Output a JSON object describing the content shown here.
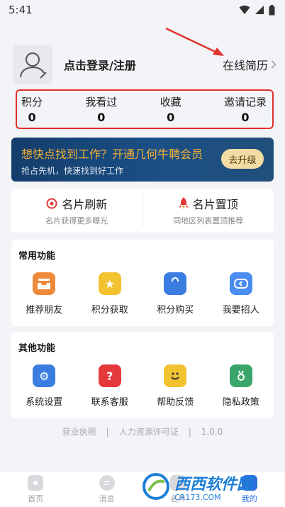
{
  "status_bar": {
    "time": "5:41"
  },
  "profile": {
    "login_text": "点击登录/注册",
    "resume_link": "在线简历"
  },
  "stats": [
    {
      "label": "积分",
      "value": "0"
    },
    {
      "label": "我看过",
      "value": "0"
    },
    {
      "label": "收藏",
      "value": "0"
    },
    {
      "label": "邀请记录",
      "value": "0"
    }
  ],
  "vip_banner": {
    "title": "想快点找到工作？开通几何牛聘会员",
    "subtitle": "抢占先机，快速找到好工作",
    "button": "去升级"
  },
  "quick_actions": [
    {
      "label": "名片刷新",
      "sub": "名片获得更多曝光",
      "icon": "target-icon",
      "color": "#e5383b"
    },
    {
      "label": "名片置顶",
      "sub": "同地区列表置顶推荐",
      "icon": "rocket-icon",
      "color": "#e5383b"
    }
  ],
  "common_functions": {
    "title": "常用功能",
    "items": [
      {
        "label": "推荐朋友",
        "icon": "inbox-tray-icon",
        "color": "#f08a3a"
      },
      {
        "label": "积分获取",
        "icon": "star-icon",
        "color": "#f2c230"
      },
      {
        "label": "积分购买",
        "icon": "shopping-bag-icon",
        "color": "#3b7de0"
      },
      {
        "label": "我要招人",
        "icon": "refresh-icon",
        "color": "#4a8cf0"
      }
    ]
  },
  "other_functions": {
    "title": "其他功能",
    "items": [
      {
        "label": "系统设置",
        "icon": "gear-icon",
        "color": "#3b7de0"
      },
      {
        "label": "联系客服",
        "icon": "question-icon",
        "color": "#e5383b"
      },
      {
        "label": "帮助反馈",
        "icon": "smile-icon",
        "color": "#f2c230"
      },
      {
        "label": "隐私政策",
        "icon": "privacy-icon",
        "color": "#3aa56a"
      }
    ]
  },
  "footer": {
    "license": "营业执照",
    "hr_permit": "人力资源许可证",
    "version": "1.0.0"
  },
  "tabs": [
    {
      "label": "首页",
      "icon": "home-icon",
      "active": false
    },
    {
      "label": "消息",
      "icon": "message-icon",
      "active": false
    },
    {
      "label": "名片",
      "icon": "card-icon",
      "active": false
    },
    {
      "label": "我的",
      "icon": "user-icon",
      "active": true
    }
  ],
  "watermark": {
    "main": "西西软件园",
    "sub": "CR173.COM"
  },
  "colors": {
    "annotation_red": "#e0322c",
    "accent_blue": "#2b6fe0",
    "vip_gold": "#f4b133"
  }
}
